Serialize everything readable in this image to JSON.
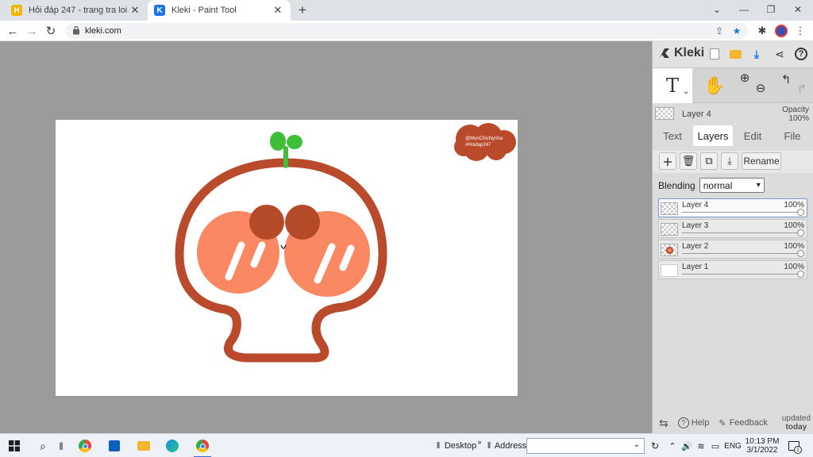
{
  "browser": {
    "tabs": [
      {
        "title": "Hỏi đáp 247 - trang tra loi",
        "favicon": "H",
        "favicon_color": "#f4b400"
      },
      {
        "title": "Kleki - Paint Tool",
        "favicon": "K",
        "favicon_color": "#1a73e8"
      }
    ],
    "url": "kleki.com"
  },
  "artwork": {
    "badge_line1": "@MunChicNynha",
    "badge_line2": "#Hoidap247"
  },
  "panel": {
    "logo": "Kleki",
    "current_layer": "Layer 4",
    "opacity_label": "Opacity",
    "opacity_value": "100%",
    "tabs": [
      "Text",
      "Layers",
      "Edit",
      "File"
    ],
    "rename_label": "Rename",
    "blending_label": "Blending",
    "blending_value": "normal",
    "layers": [
      {
        "name": "Layer 4",
        "opacity": "100%"
      },
      {
        "name": "Layer 3",
        "opacity": "100%"
      },
      {
        "name": "Layer 2",
        "opacity": "100%"
      },
      {
        "name": "Layer 1",
        "opacity": "100%"
      }
    ],
    "help_label": "Help",
    "feedback_label": "Feedback",
    "updated_line1": "updated",
    "updated_line2": "today"
  },
  "taskbar": {
    "desktop_label": "Desktop",
    "address_label": "Address",
    "language": "ENG",
    "time": "10:13 PM",
    "date": "3/1/2022",
    "notifications": "1"
  },
  "colors": {
    "outline": "#b94a2c",
    "blush": "#f98863",
    "nose": "#b54a28",
    "sprout": "#3fbe3a",
    "shadow": "#f9d0c2"
  }
}
